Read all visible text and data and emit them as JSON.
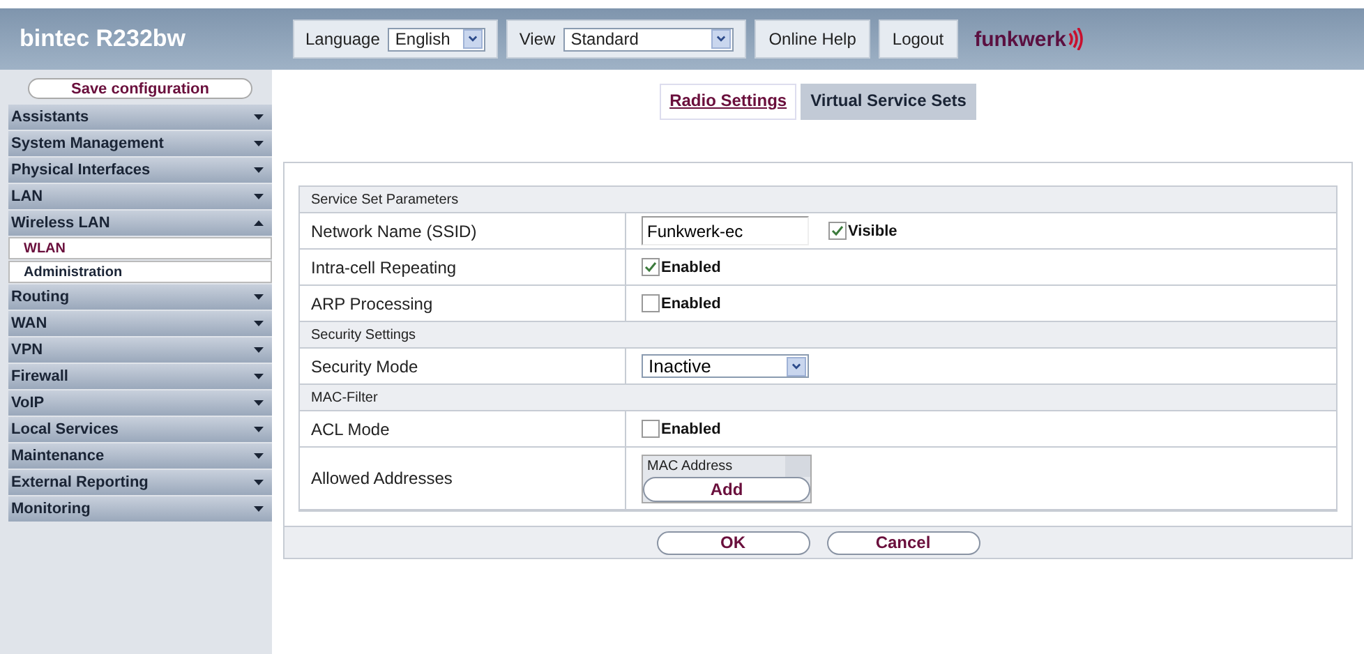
{
  "header": {
    "product": "bintec R232bw",
    "language": {
      "label": "Language",
      "value": "English"
    },
    "view": {
      "label": "View",
      "value": "Standard"
    },
    "buttons": [
      "Online Help",
      "Logout"
    ],
    "logo": "funkwerk"
  },
  "sidebar": {
    "save": "Save configuration",
    "items": [
      {
        "label": "Assistants",
        "expanded": false
      },
      {
        "label": "System Management",
        "expanded": false
      },
      {
        "label": "Physical Interfaces",
        "expanded": false
      },
      {
        "label": "LAN",
        "expanded": false
      },
      {
        "label": "Wireless LAN",
        "expanded": true,
        "children": [
          {
            "label": "WLAN",
            "selected": true
          },
          {
            "label": "Administration",
            "selected": false
          }
        ]
      },
      {
        "label": "Routing",
        "expanded": false
      },
      {
        "label": "WAN",
        "expanded": false
      },
      {
        "label": "VPN",
        "expanded": false
      },
      {
        "label": "Firewall",
        "expanded": false
      },
      {
        "label": "VoIP",
        "expanded": false
      },
      {
        "label": "Local Services",
        "expanded": false
      },
      {
        "label": "Maintenance",
        "expanded": false
      },
      {
        "label": "External Reporting",
        "expanded": false
      },
      {
        "label": "Monitoring",
        "expanded": false
      }
    ]
  },
  "tabs": [
    {
      "label": "Radio Settings",
      "selected": false
    },
    {
      "label": "Virtual Service Sets",
      "selected": true
    }
  ],
  "sections": [
    {
      "title": "Service Set Parameters",
      "rows": [
        {
          "kind": "text",
          "label": "Network Name (SSID)",
          "value": "Funkwerk-ec",
          "check": {
            "label": "Visible",
            "checked": true
          }
        },
        {
          "kind": "checkbox",
          "label": "Intra-cell Repeating",
          "check": {
            "label": "Enabled",
            "checked": true
          }
        },
        {
          "kind": "checkbox",
          "label": "ARP Processing",
          "check": {
            "label": "Enabled",
            "checked": false
          }
        }
      ]
    },
    {
      "title": "Security Settings",
      "rows": [
        {
          "kind": "select",
          "label": "Security Mode",
          "value": "Inactive"
        }
      ]
    },
    {
      "title": "MAC-Filter",
      "rows": [
        {
          "kind": "checkbox",
          "label": "ACL Mode",
          "check": {
            "label": "Enabled",
            "checked": false
          }
        },
        {
          "kind": "list",
          "label": "Allowed Addresses",
          "column": "MAC Address",
          "button": "Add"
        }
      ]
    }
  ],
  "actions": [
    "OK",
    "Cancel"
  ]
}
